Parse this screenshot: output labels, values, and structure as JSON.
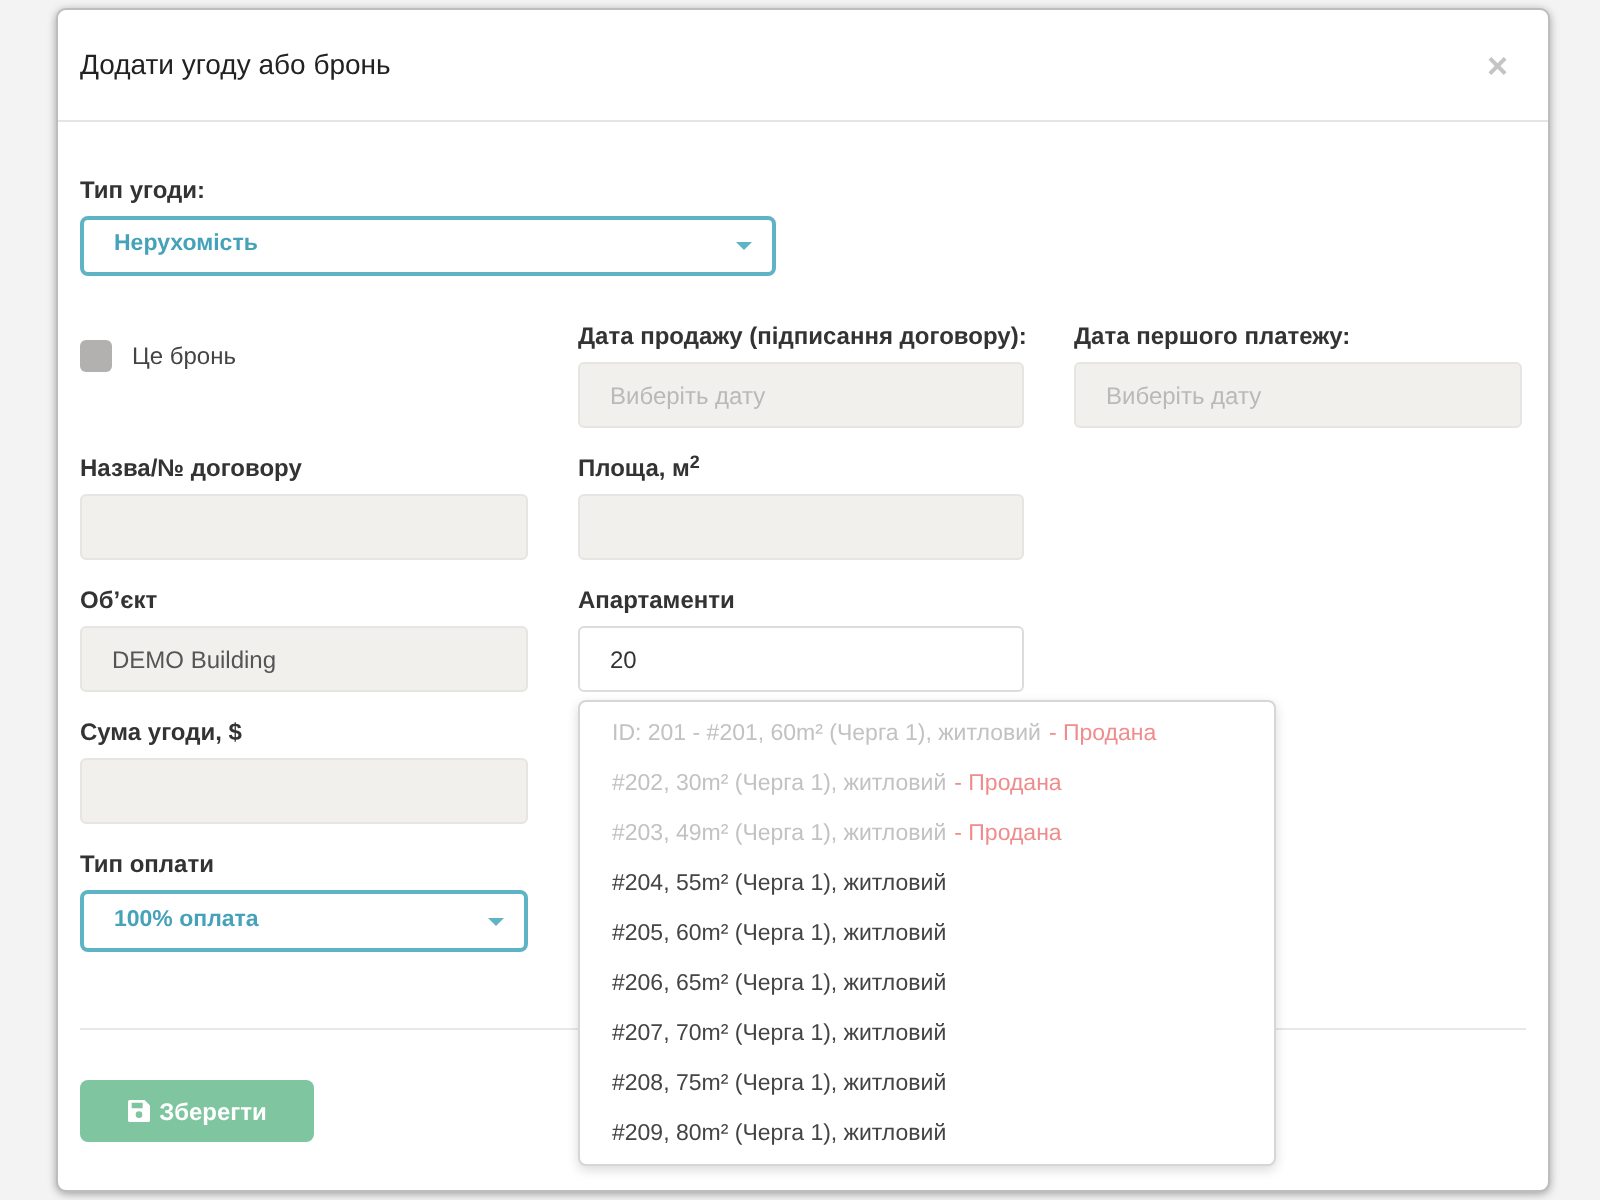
{
  "dialog": {
    "title": "Додати угоду або бронь",
    "close": "×"
  },
  "deal_type": {
    "label": "Тип угоди:",
    "value": "Нерухомість"
  },
  "reservation": {
    "label": "Це бронь",
    "checked": false
  },
  "sale_date": {
    "label": "Дата продажу (підписання договору):",
    "placeholder": "Виберіть дату"
  },
  "first_payment_date": {
    "label": "Дата першого платежу:",
    "placeholder": "Виберіть дату"
  },
  "contract_name": {
    "label": "Назва/№ договору"
  },
  "area": {
    "label": "Площа, м$^{2}$"
  },
  "object": {
    "label": "Об’єкт",
    "value": "DEMO Building"
  },
  "apartments": {
    "label": "Апартаменти",
    "value": "20",
    "expanded": true,
    "options": [
      {
        "text": "ID: 201 - #201, 60m² (Черга 1), житловий",
        "status": "- Продана",
        "disabled": true
      },
      {
        "text": "#202, 30m² (Черга 1), житловий",
        "status": "- Продана",
        "disabled": true
      },
      {
        "text": "#203, 49m² (Черга 1), житловий",
        "status": "- Продана",
        "disabled": true
      },
      {
        "text": "#204, 55m² (Черга 1), житловий",
        "disabled": false
      },
      {
        "text": "#205, 60m² (Черга 1), житловий",
        "disabled": false
      },
      {
        "text": "#206, 65m² (Черга 1), житловий",
        "disabled": false
      },
      {
        "text": "#207, 70m² (Черга 1), житловий",
        "disabled": false
      },
      {
        "text": "#208, 75m² (Черга 1), житловий",
        "disabled": false
      },
      {
        "text": "#209, 80m² (Черга 1), житловий",
        "disabled": false
      }
    ]
  },
  "deal_sum": {
    "label": "Сума угоди, $"
  },
  "payment_type": {
    "label": "Тип оплати",
    "value": "100% оплата"
  },
  "save_button": {
    "label": "Зберегти"
  }
}
